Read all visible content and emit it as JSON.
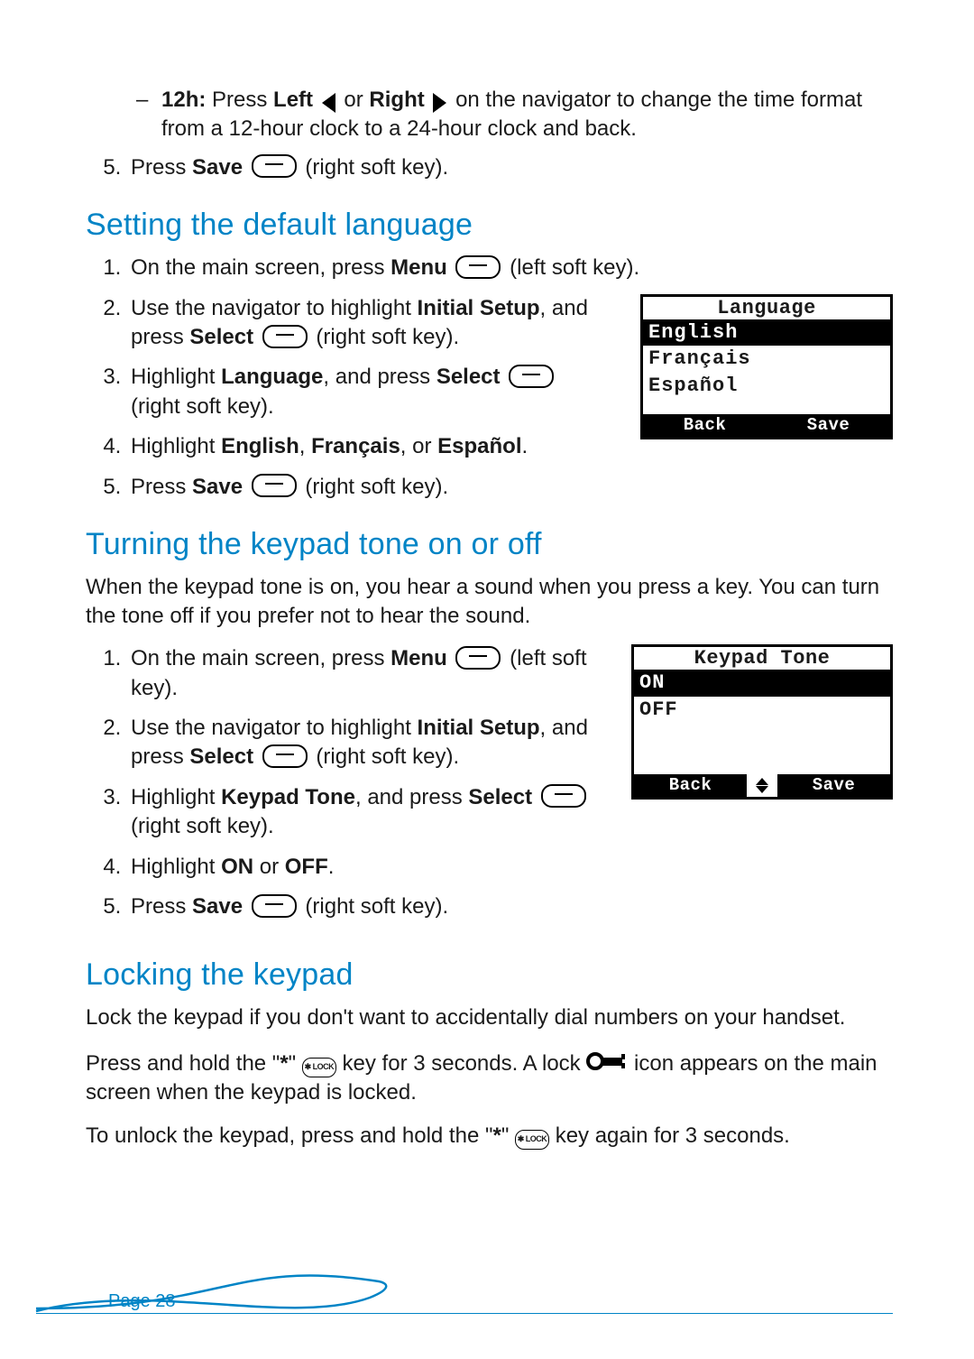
{
  "top": {
    "bullet": {
      "bold_label": "12h:",
      "text_a": "Press ",
      "bold_left": "Left",
      "text_b": " or ",
      "bold_right": "Right",
      "text_c": " on the navigator to change the time format from a 12-hour clock to a 24-hour clock and back."
    },
    "step5_a": "Press ",
    "step5_b": "Save",
    "step5_c": " (right soft key)."
  },
  "lang": {
    "heading": "Setting the default language",
    "s1a": "On the main screen, press ",
    "s1b": "Menu",
    "s1c": " (left soft key).",
    "s2a": "Use the navigator to highlight ",
    "s2b": "Initial Setup",
    "s2c": ", and press ",
    "s2d": "Select",
    "s2e": " (right soft key).",
    "s3a": "Highlight ",
    "s3b": "Language",
    "s3c": ", and press ",
    "s3d": "Select",
    "s3e": " (right soft key).",
    "s4a": "Highlight ",
    "s4b": "English",
    "s4c": ", ",
    "s4d": "Français",
    "s4e": ", or ",
    "s4f": "Español",
    "s4g": ".",
    "s5a": "Press ",
    "s5b": "Save",
    "s5c": "  (right soft key).",
    "lcd": {
      "title": "Language",
      "items": [
        "English",
        "Français",
        "Español"
      ],
      "soft_left": "Back",
      "soft_right": "Save"
    }
  },
  "tone": {
    "heading": "Turning the keypad tone on or off",
    "intro": "When the keypad tone is on, you hear a sound when you press a key. You can turn the tone off if you prefer not to hear the sound.",
    "s1a": "On the main screen, press ",
    "s1b": "Menu",
    "s1c": " (left soft key).",
    "s2a": "Use the navigator to highlight ",
    "s2b": "Initial Setup",
    "s2c": ", and press ",
    "s2d": "Select",
    "s2e": " (right soft key).",
    "s3a": "Highlight ",
    "s3b": "Keypad Tone",
    "s3c": ", and press ",
    "s3d": "Select",
    "s3e": " (right soft key).",
    "s4a": "Highlight ",
    "s4b": "ON",
    "s4c": " or ",
    "s4d": "OFF",
    "s4e": ".",
    "s5a": "Press ",
    "s5b": "Save",
    "s5c": "  (right soft key).",
    "lcd": {
      "title": "Keypad Tone",
      "items": [
        "ON",
        "OFF"
      ],
      "soft_left": "Back",
      "soft_right": "Save"
    }
  },
  "lock": {
    "heading": "Locking the keypad",
    "p1": "Lock the keypad if you don't want to accidentally dial numbers on your handset.",
    "p2a": "Press and hold the \"",
    "p2star": "*",
    "p2b": "\" ",
    "p2c": " key for 3 seconds. A lock ",
    "p2d": " icon appears on the main screen when the keypad is locked.",
    "p3a": "To unlock the keypad, press and hold the \"",
    "p3star": "*",
    "p3b": "\" ",
    "p3c": " key again for 3 seconds."
  },
  "footer": {
    "page": "Page 28"
  }
}
